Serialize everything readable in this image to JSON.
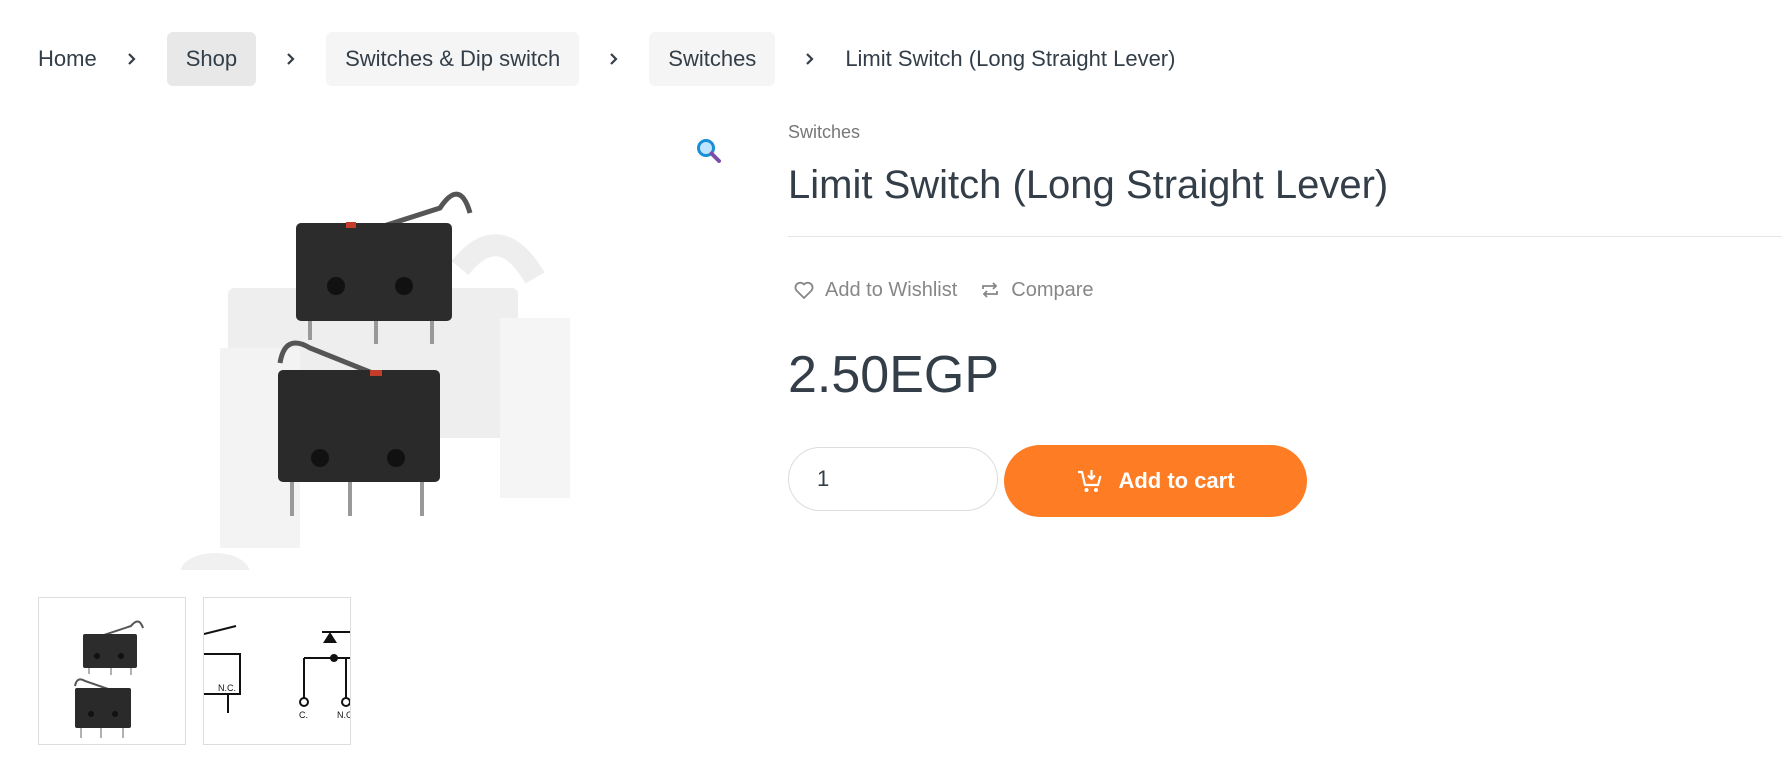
{
  "breadcrumb": {
    "home": "Home",
    "shop": "Shop",
    "category": "Switches & Dip switch",
    "subcategory": "Switches",
    "current": "Limit Switch (Long Straight Lever)"
  },
  "product": {
    "category_link": "Switches",
    "title": "Limit Switch (Long Straight Lever)",
    "price": "2.50EGP",
    "quantity": "1",
    "add_to_cart_label": "Add to cart",
    "wishlist_label": "Add to Wishlist",
    "compare_label": "Compare"
  },
  "gallery": {
    "thumbnails": [
      "thumbnail-switch-photo",
      "thumbnail-switch-diagram"
    ],
    "diagram_labels": [
      "N.C.",
      "C.",
      "N.O."
    ]
  },
  "icons": {
    "breadcrumb_separator": "chevron-right-icon",
    "zoom": "magnifier-icon",
    "wishlist": "heart-icon",
    "compare": "compare-arrows-icon",
    "cart": "cart-plus-icon"
  },
  "colors": {
    "accent": "#fe7d24",
    "text": "#333e48",
    "muted": "#878787",
    "pill_bg": "#f5f5f5",
    "pill_active_bg": "#e8e8e8",
    "zoom_icon": "#1a8fd8"
  }
}
